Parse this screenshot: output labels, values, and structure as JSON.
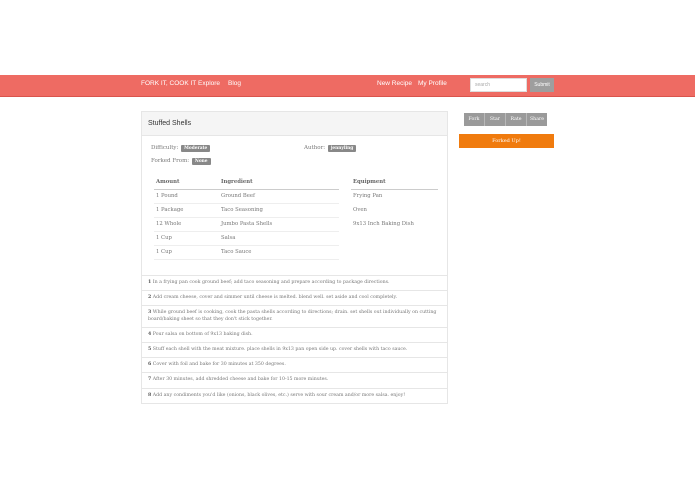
{
  "navbar": {
    "brand": "FORK IT, COOK IT",
    "explore": "Explore",
    "blog": "Blog",
    "new_recipe": "New Recipe",
    "my_profile": "My Profile",
    "search_placeholder": "search",
    "submit_label": "Submit",
    "color": "#ee6b63"
  },
  "recipe": {
    "title": "Stuffed Shells",
    "difficulty_label": "Difficulty:",
    "difficulty_value": "Moderate",
    "author_label": "Author:",
    "author_value": "jennyling",
    "forked_label": "Forked From:",
    "forked_value": "None",
    "ingredients_headers": [
      "Amount",
      "Ingredient"
    ],
    "ingredients": [
      {
        "amount": "1 Pound",
        "name": "Ground Beef"
      },
      {
        "amount": "1 Package",
        "name": "Taco Seasoning"
      },
      {
        "amount": "12 Whole",
        "name": "Jumbo Pasta Shells"
      },
      {
        "amount": "1 Cup",
        "name": "Salsa"
      },
      {
        "amount": "1 Cup",
        "name": "Taco Sauce"
      }
    ],
    "equipment_header": "Equipment",
    "equipment": [
      "Frying Pan",
      "Oven",
      "9x13 Inch Baking Dish"
    ],
    "steps": [
      {
        "num": "1",
        "text": "In a frying pan cook ground beef; add taco seasoning and prepare according to package directions."
      },
      {
        "num": "2",
        "text": "Add cream cheese, cover and simmer until cheese is melted. blend well. set aside and cool completely."
      },
      {
        "num": "3",
        "text": "While ground beef is cooking, cook the pasta shells according to directions; drain. set shells out individually on cutting board/baking sheet so that they don't stick together."
      },
      {
        "num": "4",
        "text": "Pour salsa on bottom of 9x13 baking dish."
      },
      {
        "num": "5",
        "text": "Stuff each shell with the meat mixture. place shells in 9x13 pan open side up. cover shells with taco sauce."
      },
      {
        "num": "6",
        "text": "Cover with foil and bake for 30 minutes at 350 degrees."
      },
      {
        "num": "7",
        "text": "After 30 minutes, add shredded cheese and bake for 10-15 more minutes."
      },
      {
        "num": "8",
        "text": "Add any condiments you'd like (onions, black olives, etc.) serve with sour cream and/or more salsa. enjoy!"
      }
    ]
  },
  "actions": {
    "fork": "Fork",
    "star": "Star",
    "rate": "Rate",
    "share": "Share",
    "forked_up": "Forked Up!",
    "forked_up_color": "#f07b0e"
  }
}
